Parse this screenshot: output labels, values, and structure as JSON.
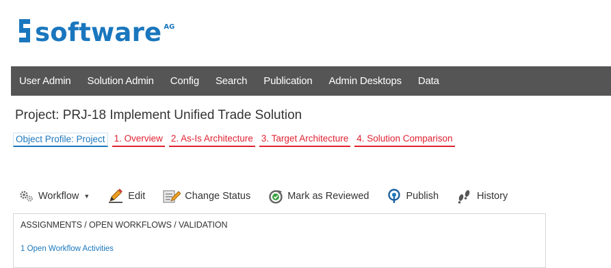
{
  "brand": {
    "logo_text": "software",
    "logo_suffix": "AG",
    "color": "#1a77be"
  },
  "nav": {
    "items": [
      {
        "label": "User Admin"
      },
      {
        "label": "Solution Admin"
      },
      {
        "label": "Config"
      },
      {
        "label": "Search"
      },
      {
        "label": "Publication"
      },
      {
        "label": "Admin Desktops"
      },
      {
        "label": "Data"
      }
    ],
    "background": "#555555"
  },
  "project": {
    "title": "Project: PRJ-18 Implement Unified Trade Solution"
  },
  "section_tabs": [
    {
      "label": "Object Profile: Project",
      "active": true
    },
    {
      "label": "1. Overview"
    },
    {
      "label": "2. As-Is Architecture"
    },
    {
      "label": "3. Target Architecture"
    },
    {
      "label": "4. Solution Comparison"
    }
  ],
  "toolbar": {
    "workflow": {
      "label": "Workflow",
      "icon": "gears-icon"
    },
    "edit": {
      "label": "Edit",
      "icon": "pencil-icon"
    },
    "change_status": {
      "label": "Change Status",
      "icon": "change-status-icon"
    },
    "mark_reviewed": {
      "label": "Mark as Reviewed",
      "icon": "reviewed-icon"
    },
    "publish": {
      "label": "Publish",
      "icon": "publish-icon"
    },
    "history": {
      "label": "History",
      "icon": "footprints-icon"
    }
  },
  "panel": {
    "title": "ASSIGNMENTS / OPEN WORKFLOWS / VALIDATION",
    "link": "1 Open Workflow Activities"
  },
  "colors": {
    "accent_blue": "#1a77be",
    "tab_red": "#e02030",
    "text": "#333333"
  }
}
